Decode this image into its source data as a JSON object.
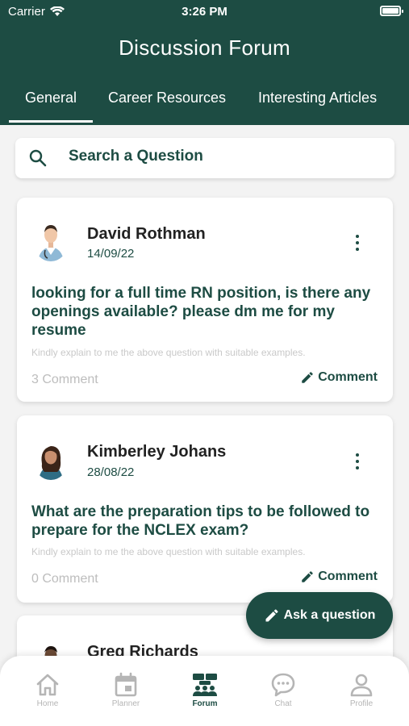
{
  "status_bar": {
    "carrier": "Carrier",
    "time": "3:26 PM"
  },
  "header": {
    "title": "Discussion Forum"
  },
  "tabs": [
    {
      "label": "General",
      "active": true
    },
    {
      "label": "Career Resources",
      "active": false
    },
    {
      "label": "Interesting Articles",
      "active": false
    }
  ],
  "search": {
    "placeholder": "Search a Question"
  },
  "posts": [
    {
      "author": "David Rothman",
      "date": "14/09/22",
      "question": "looking for a full time RN position, is there any openings available? please dm me for my resume",
      "hint": "Kindly explain to me the above question with suitable examples.",
      "comment_count": "3 Comment",
      "comment_label": "Comment"
    },
    {
      "author": "Kimberley Johans",
      "date": "28/08/22",
      "question": "What are the preparation tips to be followed to prepare for the NCLEX exam?",
      "hint": "Kindly explain to me the above question with suitable examples.",
      "comment_count": "0 Comment",
      "comment_label": "Comment"
    },
    {
      "author": "Greg Richards"
    }
  ],
  "ask_button": {
    "label": "Ask a question"
  },
  "bottom_nav": [
    {
      "label": "Home",
      "icon": "home-icon"
    },
    {
      "label": "Planner",
      "icon": "calendar-icon"
    },
    {
      "label": "Forum",
      "icon": "forum-icon",
      "active": true
    },
    {
      "label": "Chat",
      "icon": "chat-icon"
    },
    {
      "label": "Profile",
      "icon": "profile-icon"
    }
  ],
  "colors": {
    "primary": "#1d4c43",
    "background": "#f3f3f3",
    "muted": "#bdbdbd"
  }
}
